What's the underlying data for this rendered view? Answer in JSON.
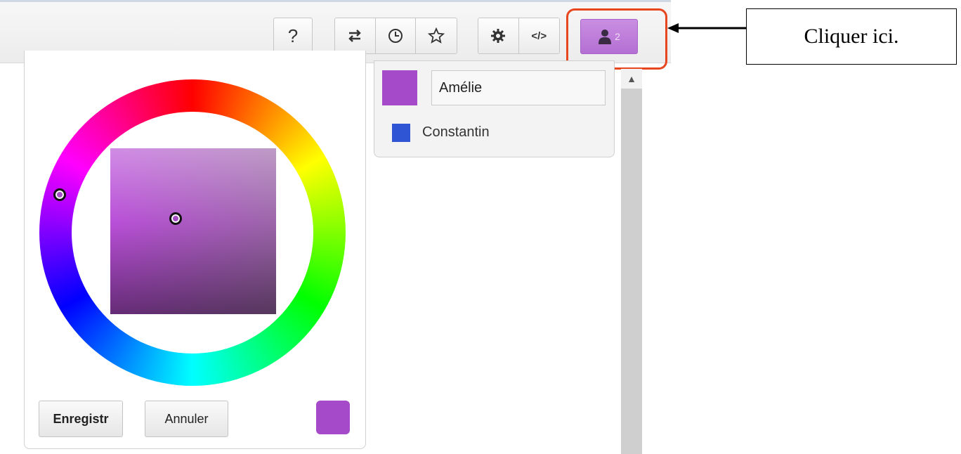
{
  "toolbar": {
    "help_label": "?",
    "icons": {
      "help": "question-mark",
      "swap": "swap-arrows-icon",
      "history": "clock-icon",
      "favorite": "star-icon",
      "settings": "gear-icon",
      "embed": "code-icon",
      "users": "user-icon"
    },
    "embed_label": "</>",
    "users_count": "2",
    "users_color": "#b46fd3"
  },
  "callout": {
    "text": "Cliquer ici.",
    "highlight_color": "#e8461f"
  },
  "color_picker": {
    "selected_color": "#a54ac8",
    "save_label": "Enregistr",
    "cancel_label": "Annuler"
  },
  "users": {
    "items": [
      {
        "name": "Amélie",
        "color": "#a54ac8",
        "editing": true
      },
      {
        "name": "Constantin",
        "color": "#2f55d4",
        "editing": false
      }
    ]
  }
}
